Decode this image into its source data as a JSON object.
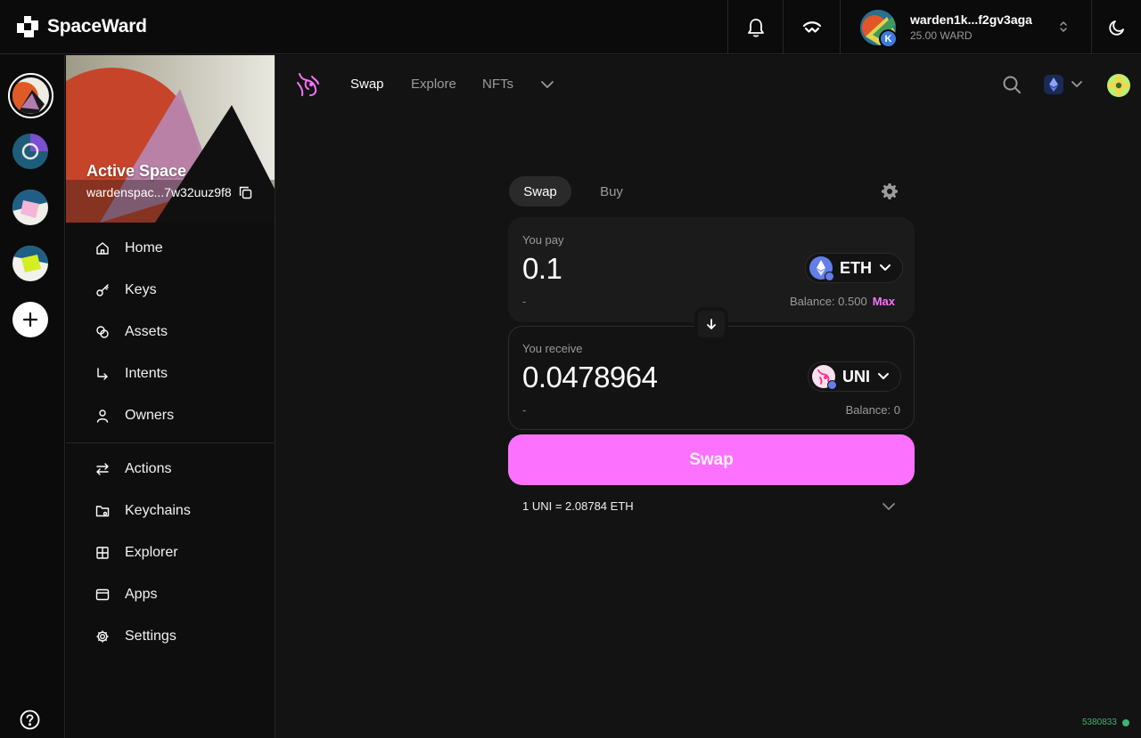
{
  "app": {
    "brand_name": "SpaceWard",
    "brand_icon": "spaceward-logo-icon"
  },
  "topbar": {
    "notifications_icon": "bell-icon",
    "walletconnect_icon": "walletconnect-icon",
    "account_name": "warden1k...f2gv3aga",
    "account_balance": "25.00 WARD",
    "account_badge": "K",
    "theme_icon": "moon-icon"
  },
  "rail": {
    "spaces": [
      "space-orange",
      "space-blue-ring",
      "space-pink-square",
      "space-lime-square"
    ],
    "add_icon": "plus-icon",
    "help_icon": "question-circle-icon"
  },
  "space": {
    "title": "Active Space",
    "address": "wardenspac...7w32uuz9f8",
    "copy_icon": "copy-icon"
  },
  "nav": {
    "primary": [
      {
        "label": "Home",
        "icon": "home-icon"
      },
      {
        "label": "Keys",
        "icon": "key-icon"
      },
      {
        "label": "Assets",
        "icon": "coins-icon"
      },
      {
        "label": "Intents",
        "icon": "corner-arrow-icon"
      },
      {
        "label": "Owners",
        "icon": "user-icon"
      }
    ],
    "secondary": [
      {
        "label": "Actions",
        "icon": "arrows-swap-icon"
      },
      {
        "label": "Keychains",
        "icon": "folder-key-icon"
      },
      {
        "label": "Explorer",
        "icon": "grid-icon"
      },
      {
        "label": "Apps",
        "icon": "window-icon"
      },
      {
        "label": "Settings",
        "icon": "gear-icon"
      }
    ]
  },
  "uniswap": {
    "tabs": [
      "Swap",
      "Explore",
      "NFTs"
    ],
    "swap_card": {
      "tab_swap": "Swap",
      "tab_buy": "Buy",
      "pay": {
        "label": "You pay",
        "amount": "0.1",
        "token": "ETH",
        "fiat": "-",
        "balance": "Balance: 0.500",
        "max_label": "Max"
      },
      "receive": {
        "label": "You receive",
        "amount": "0.0478964",
        "token": "UNI",
        "fiat": "-",
        "balance": "Balance: 0"
      },
      "submit_label": "Swap",
      "rate": "1 UNI = 2.08784 ETH"
    },
    "accent_color": "#fc72ff"
  },
  "footer": {
    "block_number": "5380833",
    "status_color": "#3fb373"
  }
}
